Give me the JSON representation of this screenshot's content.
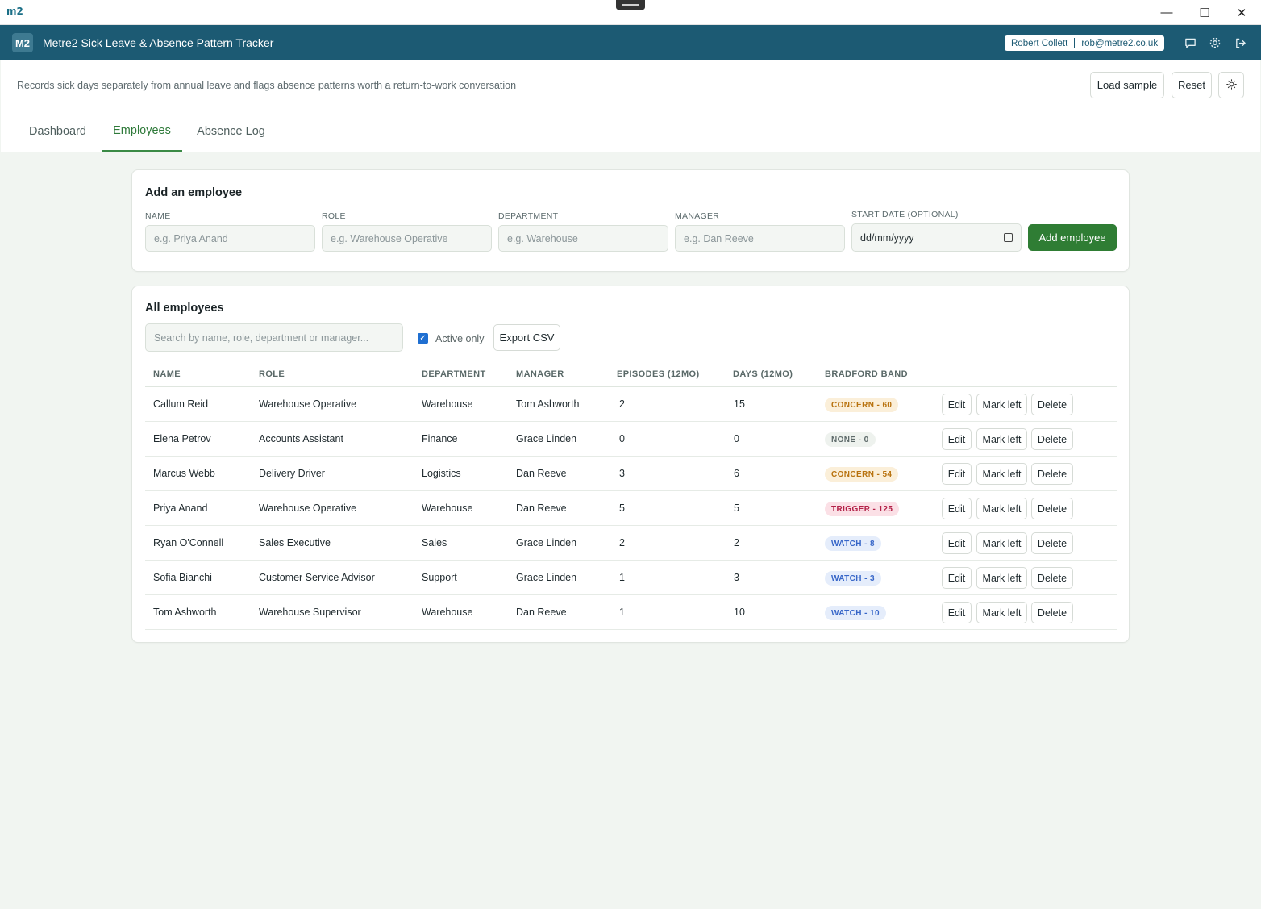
{
  "window": {
    "icon_text": "m2",
    "minimize_glyph": "—",
    "maximize_glyph": "☐",
    "close_glyph": "✕"
  },
  "header": {
    "logo": "M2",
    "title": "Metre2 Sick Leave & Absence Pattern Tracker",
    "user_name": "Robert Collett",
    "user_email": "rob@metre2.co.uk"
  },
  "subheader": {
    "description": "Records sick days separately from annual leave and flags absence patterns worth a return-to-work conversation",
    "load_sample": "Load sample",
    "reset": "Reset"
  },
  "tabs": [
    {
      "label": "Dashboard",
      "active": false
    },
    {
      "label": "Employees",
      "active": true
    },
    {
      "label": "Absence Log",
      "active": false
    }
  ],
  "add_form": {
    "title": "Add an employee",
    "fields": {
      "name": {
        "label": "NAME",
        "placeholder": "e.g. Priya Anand"
      },
      "role": {
        "label": "ROLE",
        "placeholder": "e.g. Warehouse Operative"
      },
      "department": {
        "label": "DEPARTMENT",
        "placeholder": "e.g. Warehouse"
      },
      "manager": {
        "label": "MANAGER",
        "placeholder": "e.g. Dan Reeve"
      },
      "start_date": {
        "label": "START DATE (OPTIONAL)",
        "placeholder": "dd/mm/yyyy"
      }
    },
    "submit": "Add employee"
  },
  "list": {
    "title": "All employees",
    "search_placeholder": "Search by name, role, department or manager...",
    "active_only_label": "Active only",
    "active_only_checked": true,
    "export": "Export CSV",
    "columns": [
      "NAME",
      "ROLE",
      "DEPARTMENT",
      "MANAGER",
      "EPISODES (12MO)",
      "DAYS (12MO)",
      "BRADFORD BAND"
    ],
    "actions": {
      "edit": "Edit",
      "mark_left": "Mark left",
      "delete": "Delete"
    },
    "rows": [
      {
        "name": "Callum Reid",
        "role": "Warehouse Operative",
        "department": "Warehouse",
        "manager": "Tom Ashworth",
        "episodes": "2",
        "days": "15",
        "band": "CONCERN - 60",
        "band_level": "concern"
      },
      {
        "name": "Elena Petrov",
        "role": "Accounts Assistant",
        "department": "Finance",
        "manager": "Grace Linden",
        "episodes": "0",
        "days": "0",
        "band": "NONE - 0",
        "band_level": "none"
      },
      {
        "name": "Marcus Webb",
        "role": "Delivery Driver",
        "department": "Logistics",
        "manager": "Dan Reeve",
        "episodes": "3",
        "days": "6",
        "band": "CONCERN - 54",
        "band_level": "concern"
      },
      {
        "name": "Priya Anand",
        "role": "Warehouse Operative",
        "department": "Warehouse",
        "manager": "Dan Reeve",
        "episodes": "5",
        "days": "5",
        "band": "TRIGGER - 125",
        "band_level": "trigger"
      },
      {
        "name": "Ryan O'Connell",
        "role": "Sales Executive",
        "department": "Sales",
        "manager": "Grace Linden",
        "episodes": "2",
        "days": "2",
        "band": "WATCH - 8",
        "band_level": "watch"
      },
      {
        "name": "Sofia Bianchi",
        "role": "Customer Service Advisor",
        "department": "Support",
        "manager": "Grace Linden",
        "episodes": "1",
        "days": "3",
        "band": "WATCH - 3",
        "band_level": "watch"
      },
      {
        "name": "Tom Ashworth",
        "role": "Warehouse Supervisor",
        "department": "Warehouse",
        "manager": "Dan Reeve",
        "episodes": "1",
        "days": "10",
        "band": "WATCH - 10",
        "band_level": "watch"
      }
    ]
  },
  "colors": {
    "header_bg": "#1c5a73",
    "accent_green": "#2f7d34",
    "page_bg": "#f1f5f1"
  }
}
